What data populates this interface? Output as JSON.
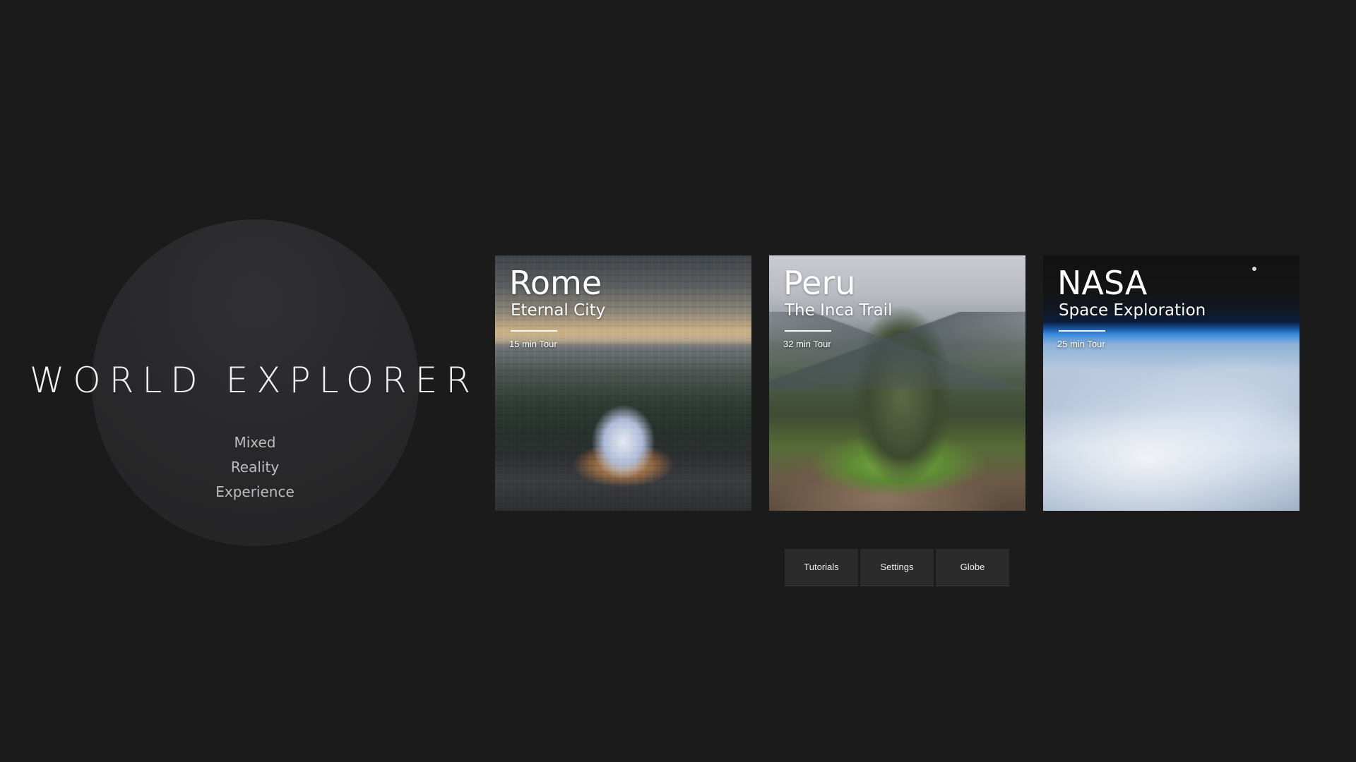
{
  "hero": {
    "title": "WORLD EXPLORER",
    "subtitle_lines": [
      "Mixed",
      "Reality",
      "Experience"
    ]
  },
  "tiles": [
    {
      "title": "Rome",
      "subtitle": "Eternal City",
      "duration": "15 min Tour",
      "image": "rome-aerial-dome-image"
    },
    {
      "title": "Peru",
      "subtitle": "The Inca Trail",
      "duration": "32 min Tour",
      "image": "machu-picchu-mountain-image"
    },
    {
      "title": "NASA",
      "subtitle": "Space Exploration",
      "duration": "25 min Tour",
      "image": "earth-from-orbit-image"
    }
  ],
  "buttons": {
    "tutorials": "Tutorials",
    "settings": "Settings",
    "globe": "Globe"
  },
  "colors": {
    "background": "#1b1b1b",
    "circle": "#2a2a2c",
    "button": "#2b2b2b",
    "text": "#ffffff"
  }
}
